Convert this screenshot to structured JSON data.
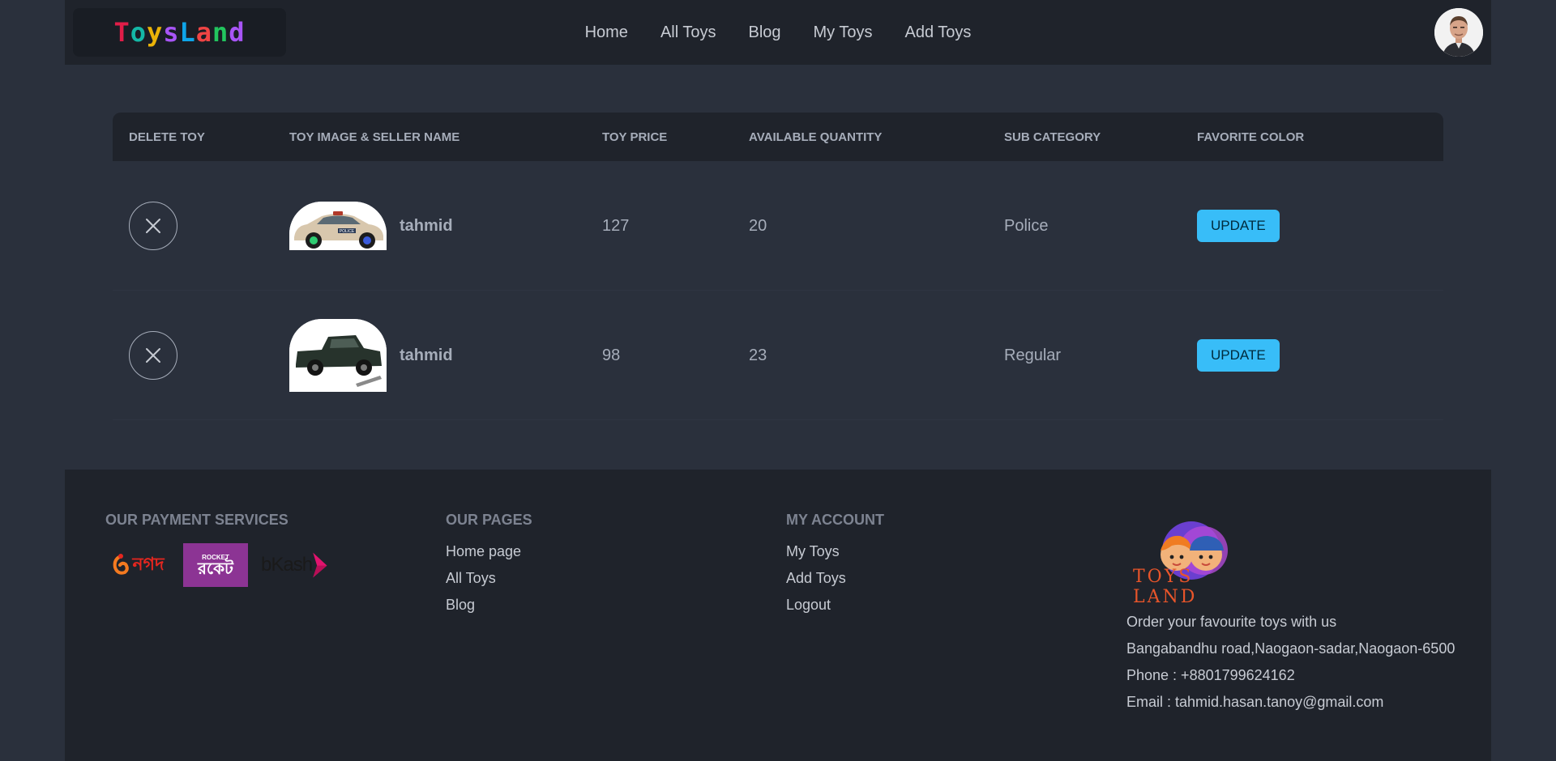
{
  "brand": {
    "letters": [
      {
        "char": "T",
        "color": "#e11d48"
      },
      {
        "char": "o",
        "color": "#14b8a6"
      },
      {
        "char": "y",
        "color": "#eab308"
      },
      {
        "char": "s",
        "color": "#a855f7"
      },
      {
        "char": "L",
        "color": "#0ea5e9"
      },
      {
        "char": "a",
        "color": "#ef4444"
      },
      {
        "char": "n",
        "color": "#22c55e"
      },
      {
        "char": "d",
        "color": "#a855f7"
      }
    ]
  },
  "nav": {
    "home": "Home",
    "all_toys": "All Toys",
    "blog": "Blog",
    "my_toys": "My Toys",
    "add_toys": "Add Toys"
  },
  "table": {
    "headers": {
      "delete": "Delete Toy",
      "image_seller": "Toy Image & Seller Name",
      "price": "Toy Price",
      "quantity": "Available Quantity",
      "subcategory": "Sub Category",
      "color": "Favorite Color"
    },
    "rows": [
      {
        "seller": "tahmid",
        "price": "127",
        "quantity": "20",
        "subcategory": "Police",
        "action": "UPDATE",
        "image": "police-car-toy"
      },
      {
        "seller": "tahmid",
        "price": "98",
        "quantity": "23",
        "subcategory": "Regular",
        "action": "UPDATE",
        "image": "pickup-truck-toy"
      }
    ]
  },
  "footer": {
    "payment": {
      "title": "Our Payment Services",
      "logos": [
        {
          "name": "nagad",
          "text": "নগদ"
        },
        {
          "name": "rocket",
          "text": "ROCKET",
          "subtext": "রকেট"
        },
        {
          "name": "bkash",
          "text": "bKash"
        }
      ]
    },
    "pages": {
      "title": "Our Pages",
      "links": [
        "Home page",
        "All Toys",
        "Blog"
      ]
    },
    "account": {
      "title": "My Account",
      "links": [
        "My Toys",
        "Add Toys",
        "Logout"
      ]
    },
    "info": {
      "logo_text": "TOYS LAND",
      "tagline": "Order your favourite toys with us",
      "address": "Bangabandhu road,Naogaon-sadar,Naogaon-6500",
      "phone": "Phone : +8801799624162",
      "email": "Email : tahmid.hasan.tanoy@gmail.com"
    }
  },
  "colors": {
    "page_bg": "#2a303c",
    "panel_bg": "#1f232b",
    "accent": "#38bdf8",
    "text": "#a6adba"
  }
}
